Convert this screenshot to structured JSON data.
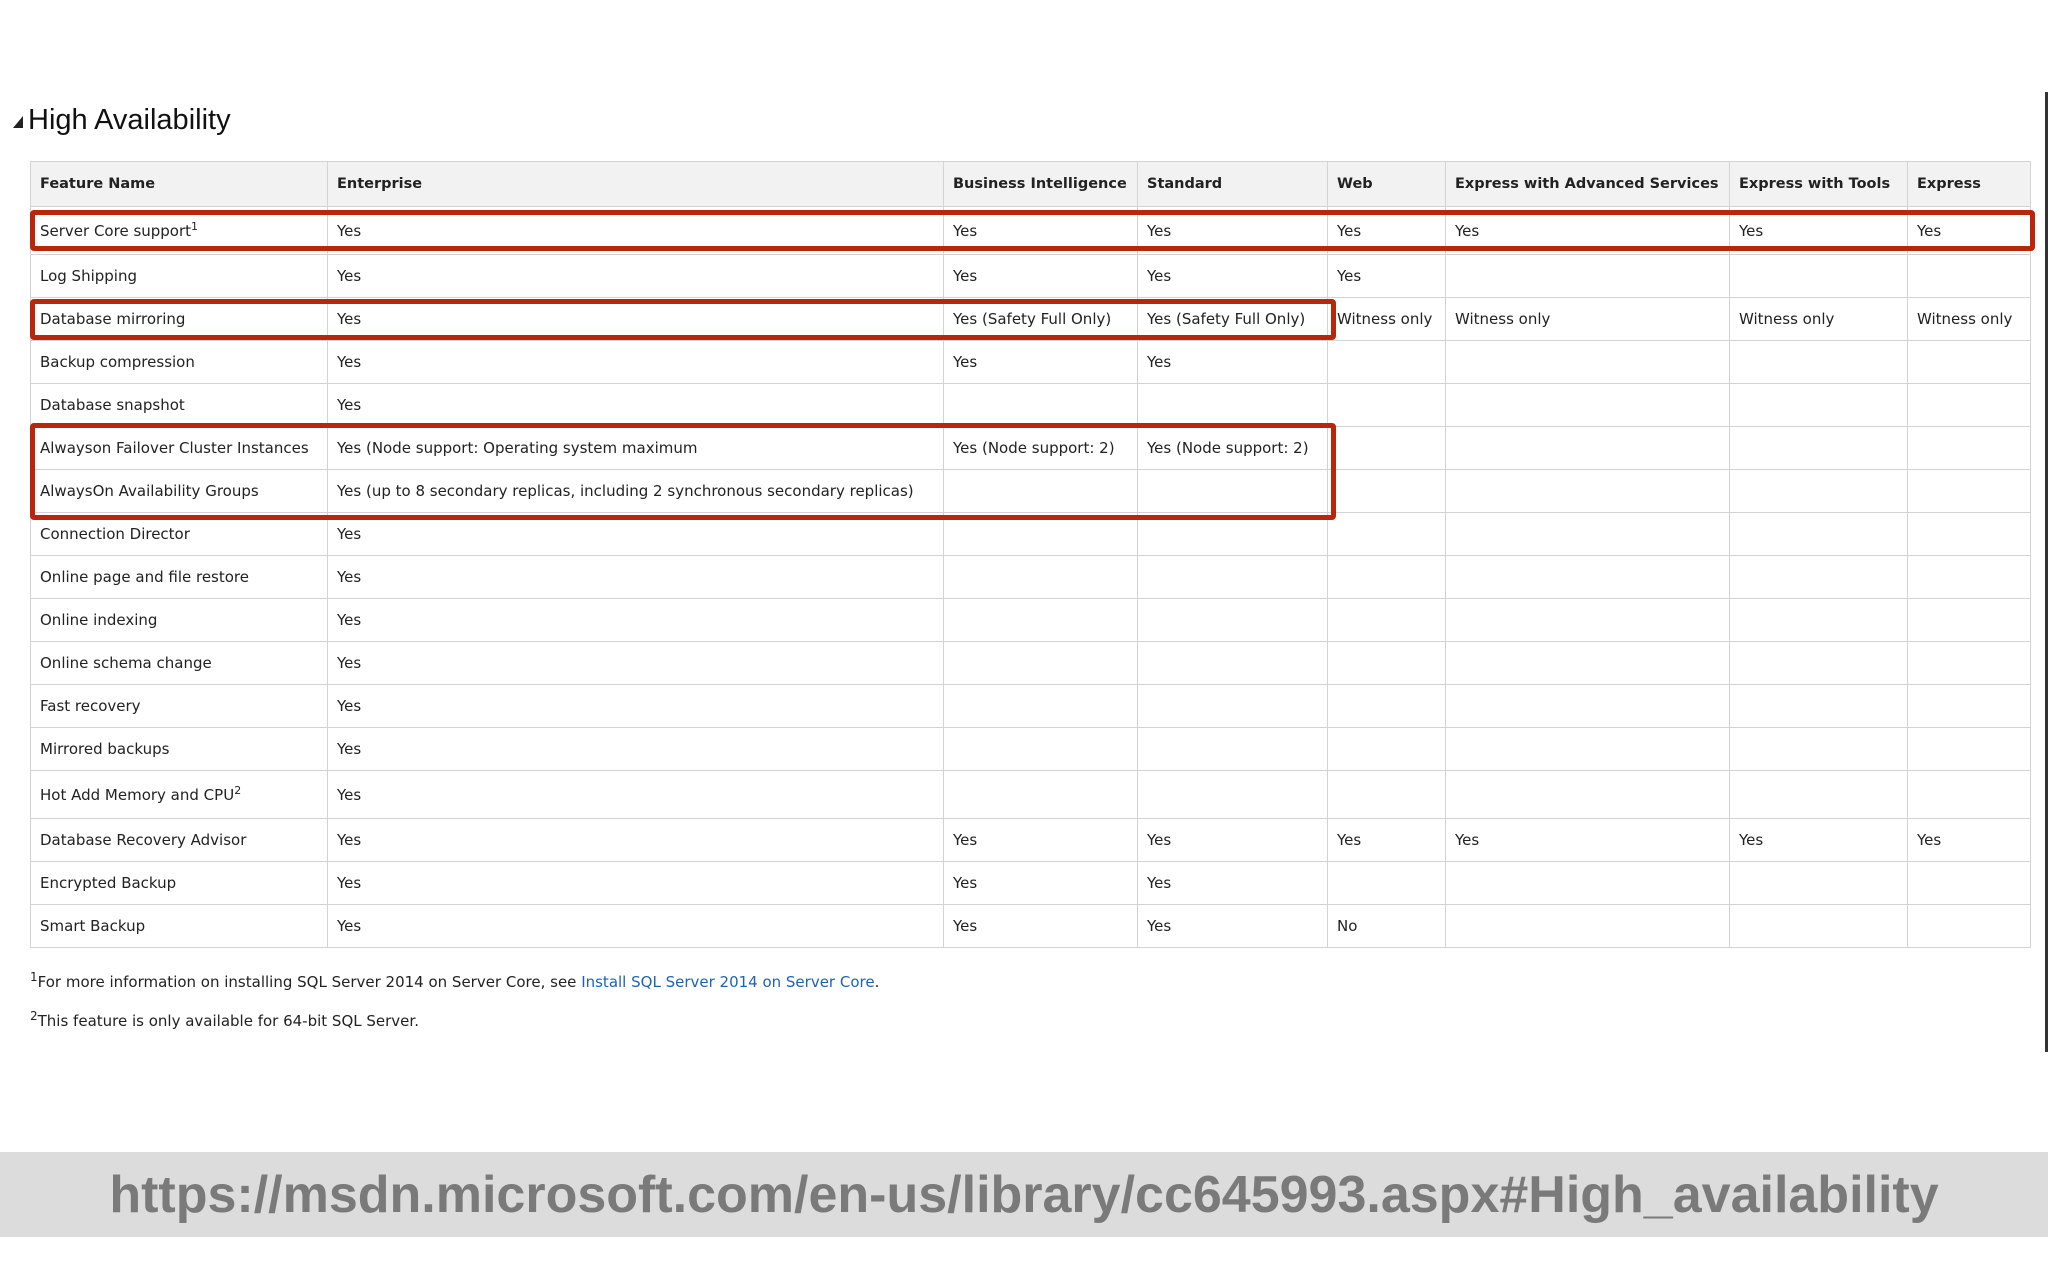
{
  "section": {
    "title": "High Availability"
  },
  "table": {
    "headers": [
      "Feature Name",
      "Enterprise",
      "Business Intelligence",
      "Standard",
      "Web",
      "Express with Advanced Services",
      "Express with Tools",
      "Express"
    ],
    "rows": [
      {
        "feature": "Server Core support",
        "sup": "1",
        "cells": [
          "Yes",
          "Yes",
          "Yes",
          "Yes",
          "Yes",
          "Yes",
          "Yes"
        ]
      },
      {
        "feature": "Log Shipping",
        "sup": "",
        "cells": [
          "Yes",
          "Yes",
          "Yes",
          "Yes",
          "",
          "",
          ""
        ]
      },
      {
        "feature": "Database mirroring",
        "sup": "",
        "cells": [
          "Yes",
          "Yes (Safety Full Only)",
          "Yes (Safety Full Only)",
          "Witness only",
          "Witness only",
          "Witness only",
          "Witness only"
        ]
      },
      {
        "feature": "Backup compression",
        "sup": "",
        "cells": [
          "Yes",
          "Yes",
          "Yes",
          "",
          "",
          "",
          ""
        ]
      },
      {
        "feature": "Database snapshot",
        "sup": "",
        "cells": [
          "Yes",
          "",
          "",
          "",
          "",
          "",
          ""
        ]
      },
      {
        "feature": "Alwayson Failover Cluster Instances",
        "sup": "",
        "cells": [
          "Yes (Node support: Operating system maximum",
          "Yes (Node support: 2)",
          "Yes (Node support: 2)",
          "",
          "",
          "",
          ""
        ]
      },
      {
        "feature": "AlwaysOn Availability Groups",
        "sup": "",
        "cells": [
          "Yes (up to 8 secondary replicas, including 2 synchronous secondary replicas)",
          "",
          "",
          "",
          "",
          "",
          ""
        ]
      },
      {
        "feature": "Connection Director",
        "sup": "",
        "cells": [
          "Yes",
          "",
          "",
          "",
          "",
          "",
          ""
        ]
      },
      {
        "feature": "Online page and file restore",
        "sup": "",
        "cells": [
          "Yes",
          "",
          "",
          "",
          "",
          "",
          ""
        ]
      },
      {
        "feature": "Online indexing",
        "sup": "",
        "cells": [
          "Yes",
          "",
          "",
          "",
          "",
          "",
          ""
        ]
      },
      {
        "feature": "Online schema change",
        "sup": "",
        "cells": [
          "Yes",
          "",
          "",
          "",
          "",
          "",
          ""
        ]
      },
      {
        "feature": "Fast recovery",
        "sup": "",
        "cells": [
          "Yes",
          "",
          "",
          "",
          "",
          "",
          ""
        ]
      },
      {
        "feature": "Mirrored backups",
        "sup": "",
        "cells": [
          "Yes",
          "",
          "",
          "",
          "",
          "",
          ""
        ]
      },
      {
        "feature": "Hot Add Memory and CPU",
        "sup": "2",
        "cells": [
          "Yes",
          "",
          "",
          "",
          "",
          "",
          ""
        ]
      },
      {
        "feature": "Database Recovery Advisor",
        "sup": "",
        "cells": [
          "Yes",
          "Yes",
          "Yes",
          "Yes",
          "Yes",
          "Yes",
          "Yes"
        ]
      },
      {
        "feature": "Encrypted Backup",
        "sup": "",
        "cells": [
          "Yes",
          "Yes",
          "Yes",
          "",
          "",
          "",
          ""
        ]
      },
      {
        "feature": "Smart Backup",
        "sup": "",
        "cells": [
          "Yes",
          "Yes",
          "Yes",
          "No",
          "",
          "",
          ""
        ]
      }
    ]
  },
  "footnotes": {
    "note1": {
      "sup": "1",
      "text": "For more information on installing SQL Server 2014 on Server Core, see ",
      "link": "Install SQL Server 2014 on Server Core",
      "end": "."
    },
    "note2": {
      "sup": "2",
      "text": "This feature is only available for 64-bit SQL Server."
    }
  },
  "banner": {
    "url": "https://msdn.microsoft.com/en-us/library/cc645993.aspx#High_availability"
  },
  "colors": {
    "highlight": "#b8260c",
    "link": "#1e63b0",
    "header_bg": "#f2f2f2",
    "banner_bg": "#dcdcdc"
  }
}
